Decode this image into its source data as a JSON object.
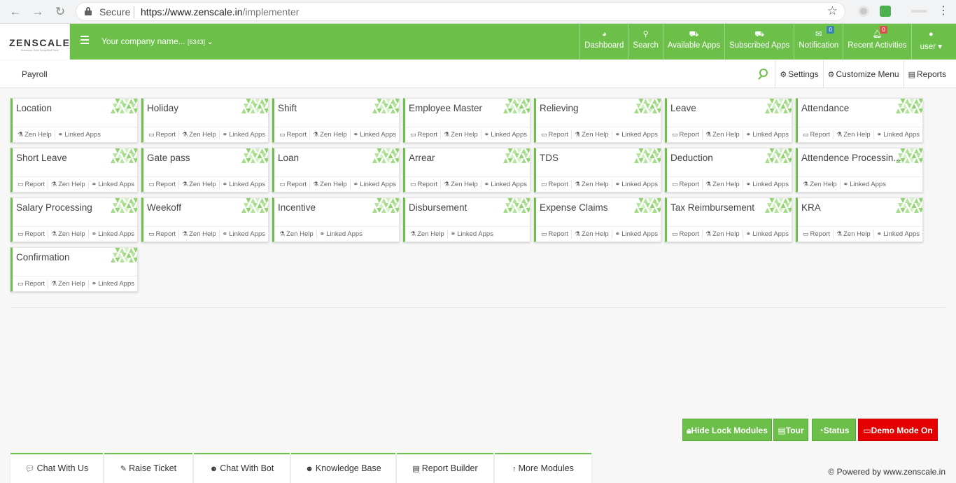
{
  "browser": {
    "secure_label": "Secure",
    "url_host": "https://www.zenscale.in",
    "url_path": "/implementer"
  },
  "header": {
    "logo_text": "ZENSCALE",
    "logo_tagline": "Business Gets Simplified Here",
    "company_name": "Your company name...",
    "company_code": "[6343]",
    "nav": [
      {
        "label": "Dashboard",
        "icon": "dashboard-icon"
      },
      {
        "label": "Search",
        "icon": "search-icon"
      },
      {
        "label": "Available Apps",
        "icon": "cart-icon"
      },
      {
        "label": "Subscribed Apps",
        "icon": "cart-icon"
      },
      {
        "label": "Notification",
        "icon": "envelope-icon",
        "badge": "0",
        "badge_color": "#3a87ad"
      },
      {
        "label": "Recent Activities",
        "icon": "bell-icon",
        "badge": "0",
        "badge_color": "#d9534f"
      },
      {
        "label": "user",
        "icon": "user-icon"
      }
    ]
  },
  "subbar": {
    "title": "Payroll",
    "settings": "Settings",
    "customize": "Customize Menu",
    "reports": "Reports"
  },
  "link_labels": {
    "report": "Report",
    "zen_help": "Zen Help",
    "linked_apps": "Linked Apps"
  },
  "modules": [
    {
      "name": "Location",
      "report": false
    },
    {
      "name": "Holiday",
      "report": true
    },
    {
      "name": "Shift",
      "report": true
    },
    {
      "name": "Employee Master",
      "report": true
    },
    {
      "name": "Relieving",
      "report": true
    },
    {
      "name": "Leave",
      "report": true
    },
    {
      "name": "Attendance",
      "report": true
    },
    {
      "name": "Short Leave",
      "report": true
    },
    {
      "name": "Gate pass",
      "report": true
    },
    {
      "name": "Loan",
      "report": true
    },
    {
      "name": "Arrear",
      "report": true
    },
    {
      "name": "TDS",
      "report": true
    },
    {
      "name": "Deduction",
      "report": true
    },
    {
      "name": "Attendence Processin...",
      "report": false
    },
    {
      "name": "Salary Processing",
      "report": true
    },
    {
      "name": "Weekoff",
      "report": true
    },
    {
      "name": "Incentive",
      "report": false
    },
    {
      "name": "Disbursement",
      "report": false
    },
    {
      "name": "Expense Claims",
      "report": true
    },
    {
      "name": "Tax Reimbursement",
      "report": true
    },
    {
      "name": "KRA",
      "report": true
    },
    {
      "name": "Confirmation",
      "report": true
    }
  ],
  "actions": {
    "hide_lock": "Hide Lock Modules",
    "tour": "Tour",
    "status": "Status",
    "demo": "Demo Mode On"
  },
  "footer": {
    "tabs": [
      "Chat With Us",
      "Raise Ticket",
      "Chat With Bot",
      "Knowledge Base",
      "Report Builder",
      "More Modules"
    ],
    "powered": "© Powered by www.zenscale.in"
  },
  "colors": {
    "brand_green": "#6cc04a",
    "demo_red": "#e50000"
  }
}
